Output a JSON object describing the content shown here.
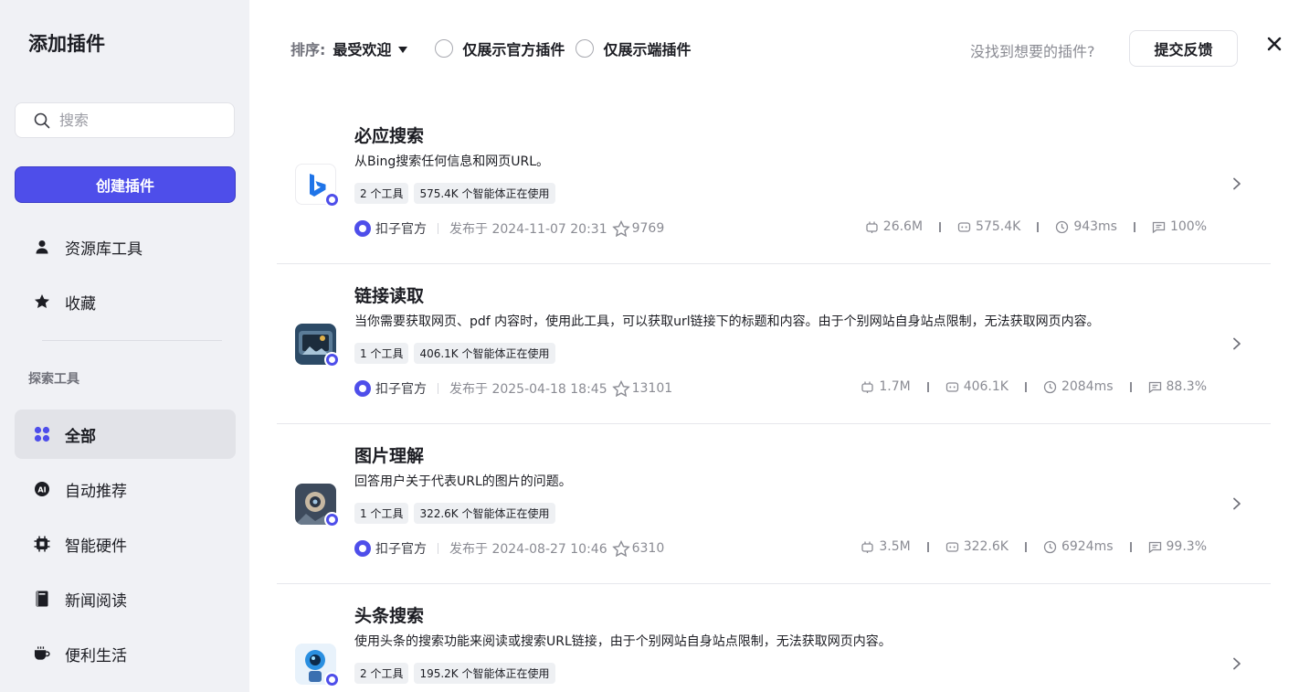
{
  "sidebar": {
    "title": "添加插件",
    "search_placeholder": "搜索",
    "create_label": "创建插件",
    "items": [
      {
        "label": "资源库工具",
        "icon": "user-icon"
      },
      {
        "label": "收藏",
        "icon": "star-icon"
      }
    ],
    "section_title": "探索工具",
    "categories": [
      {
        "label": "全部",
        "icon": "grid-icon",
        "active": true
      },
      {
        "label": "自动推荐",
        "icon": "ai-icon"
      },
      {
        "label": "智能硬件",
        "icon": "chip-icon"
      },
      {
        "label": "新闻阅读",
        "icon": "book-icon"
      },
      {
        "label": "便利生活",
        "icon": "cup-icon"
      }
    ]
  },
  "toolbar": {
    "sort_label": "排序:",
    "sort_value": "最受欢迎",
    "filter_official": "仅展示官方插件",
    "filter_client": "仅展示端插件",
    "not_found": "没找到想要的插件?",
    "feedback_label": "提交反馈"
  },
  "plugins": [
    {
      "title": "必应搜索",
      "desc": "从Bing搜索任何信息和网页URL。",
      "tags": [
        "2 个工具",
        "575.4K 个智能体正在使用"
      ],
      "publisher": "扣子官方",
      "published": "发布于 2024-11-07 20:31",
      "favorites": "9769",
      "calls": "26.6M",
      "bots": "575.4K",
      "latency": "943ms",
      "success": "100%",
      "logo_colors": [
        "#ffffff",
        "#1f74e8"
      ]
    },
    {
      "title": "链接读取",
      "desc": "当你需要获取网页、pdf 内容时，使用此工具，可以获取url链接下的标题和内容。由于个别网站自身站点限制，无法获取网页内容。",
      "tags": [
        "1 个工具",
        "406.1K 个智能体正在使用"
      ],
      "publisher": "扣子官方",
      "published": "发布于 2025-04-18 18:45",
      "favorites": "13101",
      "calls": "1.7M",
      "bots": "406.1K",
      "latency": "2084ms",
      "success": "88.3%",
      "logo_colors": [
        "#2c4a66",
        "#a8c4d8"
      ]
    },
    {
      "title": "图片理解",
      "desc": "回答用户关于代表URL的图片的问题。",
      "tags": [
        "1 个工具",
        "322.6K 个智能体正在使用"
      ],
      "publisher": "扣子官方",
      "published": "发布于 2024-08-27 10:46",
      "favorites": "6310",
      "calls": "3.5M",
      "bots": "322.6K",
      "latency": "6924ms",
      "success": "99.3%",
      "logo_colors": [
        "#3d4a5c",
        "#c7b8a2"
      ]
    },
    {
      "title": "头条搜索",
      "desc": "使用头条的搜索功能来阅读或搜索URL链接，由于个别网站自身站点限制，无法获取网页内容。",
      "tags": [
        "2 个工具",
        "195.2K 个智能体正在使用"
      ],
      "logo_colors": [
        "#e8f2fb",
        "#2a8fe0"
      ]
    }
  ],
  "colors": {
    "accent": "#4e4eea",
    "sidebar_bg": "#f0f1f5"
  }
}
